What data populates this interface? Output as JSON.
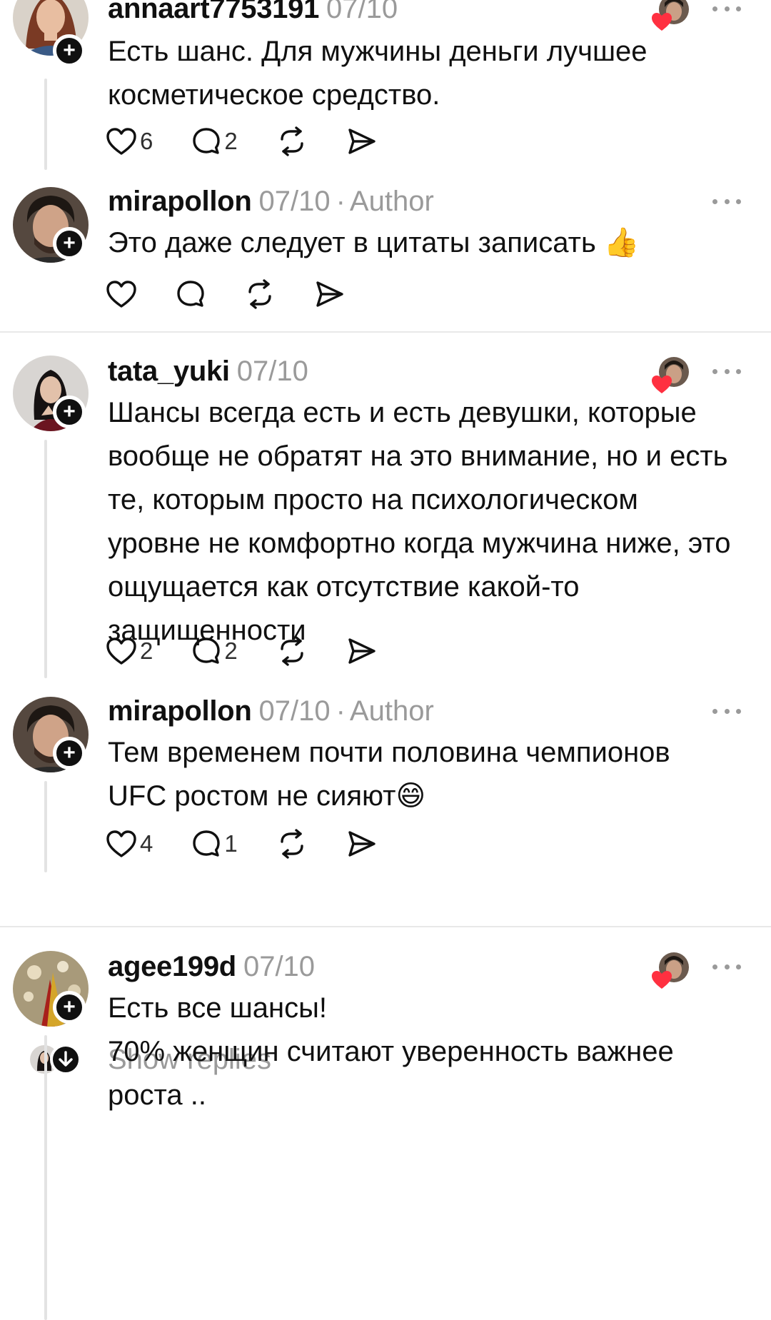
{
  "posts": [
    {
      "username": "annaart7753191",
      "date": "07/10",
      "body": "Есть шанс. Для мужчины деньги лучшее косметическое средство.",
      "likes": "6",
      "replies": "2",
      "avatar": "woman-red-hair-avatar",
      "liked_by_author": true
    },
    {
      "username": "mirapollon",
      "date": "07/10",
      "author_label": "Author",
      "body": "Это даже следует в цитаты записать 👍",
      "likes": "",
      "replies": "",
      "avatar": "man-dark-hair-avatar"
    },
    {
      "username": "tata_yuki",
      "date": "07/10",
      "body": "Шансы всегда есть и есть девушки, которые вообще не обратят на это внимание, но и есть те, которым просто на психологическом уровне не комфортно когда мужчина ниже, это ощущается как отсутствие какой-то защищенности",
      "likes": "2",
      "replies": "2",
      "avatar": "woman-dark-hair-avatar",
      "liked_by_author": true
    },
    {
      "username": "mirapollon",
      "date": "07/10",
      "author_label": "Author",
      "body": "Тем временем почти половина чемпионов UFC ростом не сияют😄",
      "likes": "4",
      "replies": "1",
      "avatar": "man-dark-hair-avatar"
    },
    {
      "username": "agee199d",
      "date": "07/10",
      "body_lines": [
        "Есть все шансы!",
        "70% женщин считают уверенность важнее роста .."
      ],
      "avatar": "golden-abstract-avatar",
      "liked_by_author": true
    }
  ],
  "show_replies_label": "Show replies",
  "icons": {
    "like": "heart-outline-icon",
    "reply": "speech-bubble-icon",
    "repost": "repost-arrows-icon",
    "share": "send-icon",
    "more": "ellipsis-icon",
    "follow": "plus-icon",
    "liked": "red-heart-icon",
    "expand": "arrow-down-icon"
  },
  "colors": {
    "text": "#101010",
    "muted": "#9a9a9a",
    "heart": "#ff3040",
    "divider": "#e8e8e8",
    "thread_line": "#e3e3e3"
  }
}
